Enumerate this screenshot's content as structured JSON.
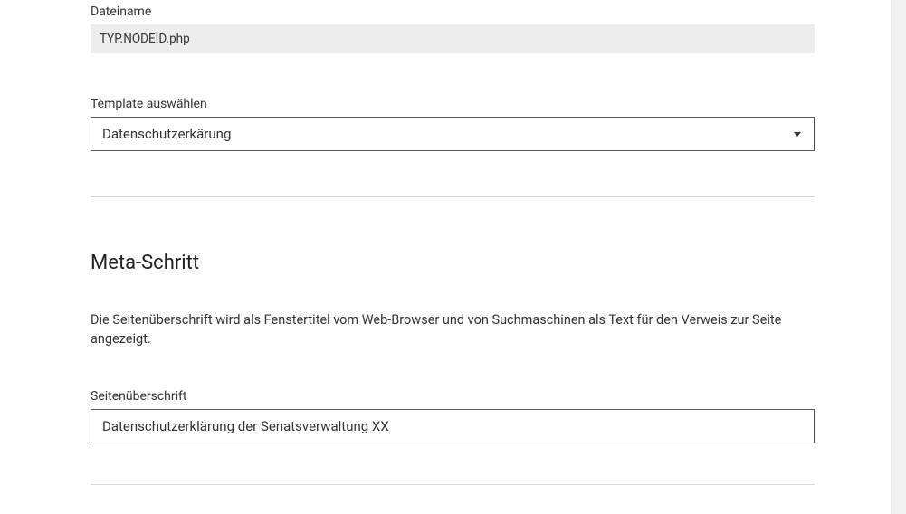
{
  "dateiname": {
    "label": "Dateiname",
    "value": "TYP.NODEID.php"
  },
  "template": {
    "label": "Template auswählen",
    "selected": "Datenschutzerkärung"
  },
  "meta": {
    "heading": "Meta-Schritt",
    "help": "Die Seitenüberschrift wird als Fenstertitel vom Web-Browser und von Suchmaschinen als Text für den Verweis zur Seite angezeigt.",
    "pageTitle": {
      "label": "Seitenüberschrift",
      "value": "Datenschutzerklärung der Senatsverwaltung XX"
    }
  }
}
